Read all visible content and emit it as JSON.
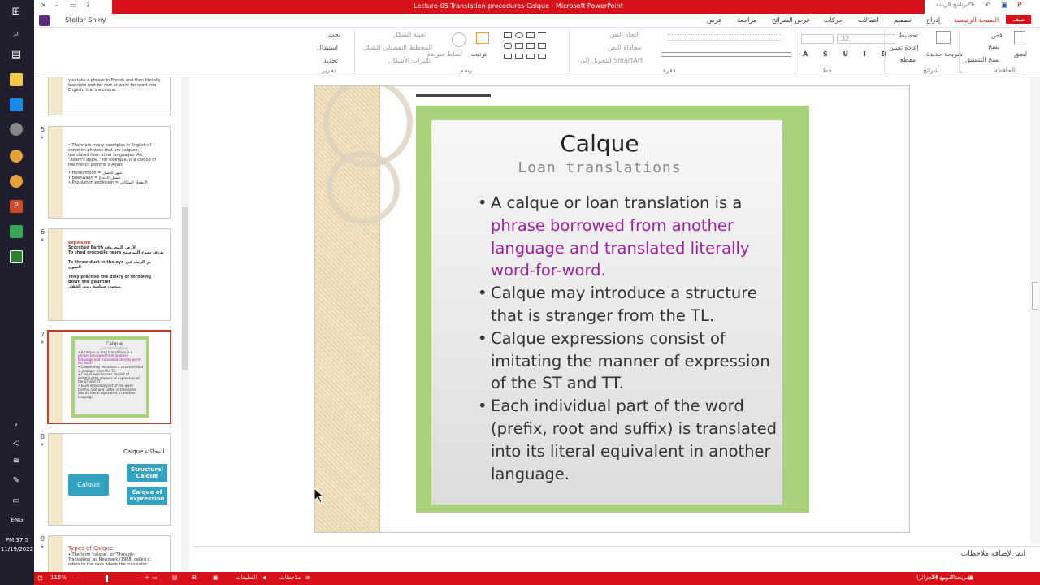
{
  "colors": {
    "accent": "#d7111a",
    "slide_green": "#a8d37c",
    "highlight": "#a020a0"
  },
  "taskbar": {
    "icons": [
      "windows-icon",
      "search-icon",
      "task-view-icon",
      "file-explorer-icon",
      "edge-icon",
      "app-icon",
      "chrome-icon",
      "chrome-icon",
      "powerpoint-icon",
      "camtasia-icon",
      "camtasia-icon"
    ],
    "time": "PM 37:5",
    "date": "11/19/2022",
    "lang": "ENG"
  },
  "titlebar": {
    "title": "Lecture-05-Translation-procedures-Calque  -  Microsoft PowerPoint",
    "app_name": "Stellar Shiny",
    "user_label": "برنامج الريادة"
  },
  "tabs": {
    "file": "ملف",
    "home": "الصفحة الرئيسية",
    "insert": "إدراج",
    "design": "تصميم",
    "transitions": "انتقالات",
    "animations": "حركات",
    "slideshow": "عرض الشرائح",
    "review": "مراجعة",
    "view": "عرض"
  },
  "ribbon": {
    "paste": "لصق",
    "cut": "قص",
    "copy": "نسخ",
    "format_painter": "نسخ التنسيق",
    "clipboard_group": "الحافظة",
    "new_slide": "شريحة جديدة",
    "layout": "تخطيط",
    "reset": "إعادة تعيين",
    "section": "مقطع",
    "slides_group": "شرائح",
    "font_size": "32",
    "font_group": "خط",
    "text_direction": "اتجاه النص",
    "align_text": "محاذاة النص",
    "convert_smartart": "التحويل إلى SmartArt",
    "paragraph_group": "فقرة",
    "arrange": "ترتيب",
    "quick_styles": "أنماط سريعة",
    "shape_fill": "تعبئة الشكل",
    "shape_outline": "المخطط التفصيلي للشكل",
    "shape_effects": "تأثيرات الأشكال",
    "drawing_group": "رسم",
    "find": "بحث",
    "replace": "استبدال",
    "select": "تحديد",
    "editing_group": "تحرير"
  },
  "thumbnails": [
    {
      "num": "",
      "lines": [
        "you take a phrase in French and then literally",
        "translate root-for-root or word-for-word into",
        "English, that's a calque."
      ]
    },
    {
      "num": "5",
      "lines": [
        "• There are many examples in English of",
        "common phrases that are calques,",
        "translated from other languages. An",
        "\"Adam's apple,\" for example, is a calque of",
        "the French pomme d'Adam",
        "",
        "• Honeymoon = شهر العسل",
        "• Brainwash = غسيل الدماغ",
        "• Population explosion = الانفجار السكاني"
      ]
    },
    {
      "num": "6",
      "lines": [
        "Explosion",
        "Scorched Earth  الأرض المحروقة",
        "To shed crocodile tears  يذرف دموع التماسيح",
        "",
        "To throw dust in the eye  ذر الرماد في العيون",
        "",
        "They practise the policy of throwing down the gauntlet",
        "يتبعون سياسة رمي القفاز"
      ]
    },
    {
      "num": "7",
      "lines": [
        "Calque",
        "Loan translations",
        "• A calque or loan translation is a",
        "phrase borrowed from another",
        "language and translated literally word-",
        "for-word.",
        "• Calque may introduce a structure that",
        "is stranger from the TL.",
        "• Calque expressions consist of",
        "imitating the manner of expression of",
        "the ST and TT.",
        "• Each individual part of the word",
        "(prefix, root and suffix) is translated",
        "into its literal equivalent in another",
        "language."
      ]
    },
    {
      "num": "8",
      "lines": [
        "Calque  المحاكاة",
        "Calque",
        "Structural Calque",
        "Calque of expression"
      ]
    },
    {
      "num": "9",
      "lines": [
        "Types of Calque",
        "• The term 'calque', or 'Through-",
        "Translation' as Newmark (1988) called it,",
        "refers to the case where the translator"
      ]
    }
  ],
  "slide": {
    "title": "Calque",
    "subtitle": "Loan translations",
    "bullets": [
      {
        "parts": [
          {
            "text": "A calque or loan translation is a ",
            "hl": false
          },
          {
            "text": "phrase borrowed from another language and translated literally word-for-word.",
            "hl": true
          }
        ]
      },
      {
        "parts": [
          {
            "text": "Calque may introduce a structure that is stranger from the TL.",
            "hl": false
          }
        ]
      },
      {
        "parts": [
          {
            "text": "Calque expressions consist of imitating the manner of expression of the ST and TT.",
            "hl": false
          }
        ]
      },
      {
        "parts": [
          {
            "text": "Each individual part of the word (prefix, root and suffix) is translated into its literal equivalent in another language.",
            "hl": false
          }
        ]
      }
    ]
  },
  "notes_placeholder": "انقر لإضافة ملاحظات",
  "status": {
    "slide_info": "شريحة 7 من 14",
    "language": "العربية (الجزائر)",
    "notes": "ملاحظات",
    "comments": "التعليقات",
    "zoom": "115%"
  }
}
